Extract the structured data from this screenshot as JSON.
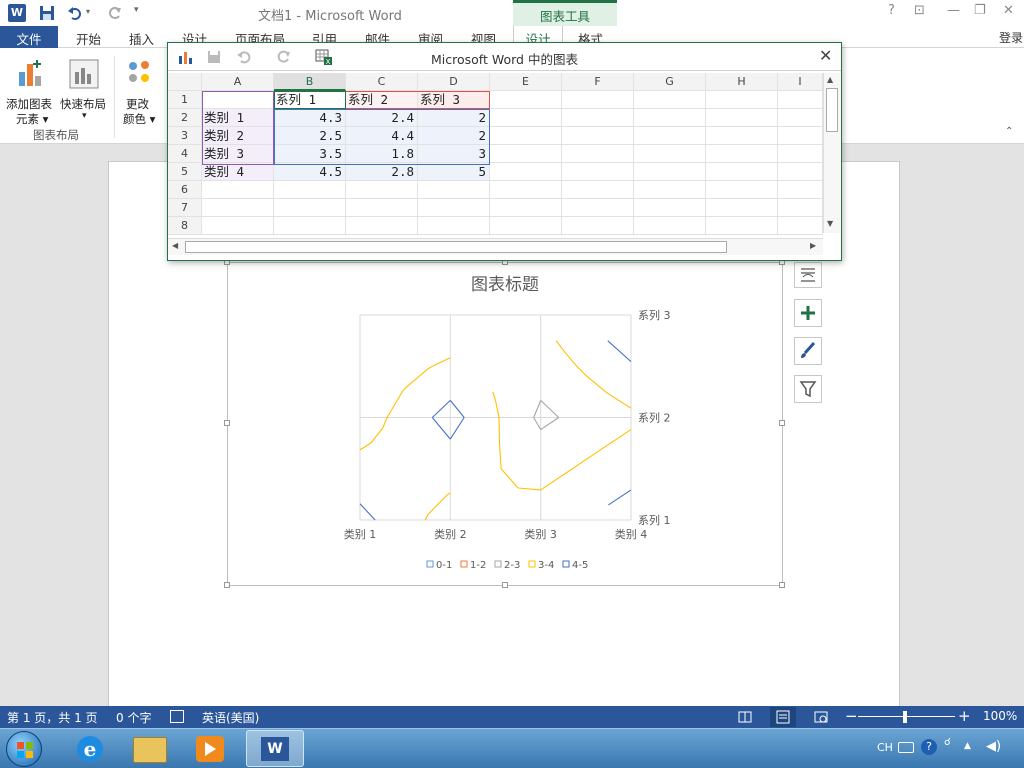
{
  "app": {
    "window_title": "文档1 - Microsoft Word",
    "context_tools_label": "图表工具",
    "help_icon": "?",
    "login_label": "登录"
  },
  "tabs": [
    "文件",
    "开始",
    "插入",
    "设计",
    "页面布局",
    "引用",
    "邮件",
    "审阅",
    "视图",
    "设计",
    "格式"
  ],
  "ribbon": {
    "add_element_line1": "添加图表",
    "add_element_line2": "元素",
    "quick_layout": "快速布局",
    "change_colors_line1": "更改",
    "change_colors_line2": "颜色",
    "group_label": "图表布局"
  },
  "data_window": {
    "title": "Microsoft Word 中的图表",
    "columns": [
      "A",
      "B",
      "C",
      "D",
      "E",
      "F",
      "G",
      "H",
      "I"
    ],
    "rows": [
      "1",
      "2",
      "3",
      "4",
      "5",
      "6",
      "7",
      "8"
    ],
    "header_row": [
      "",
      "系列 1",
      "系列 2",
      "系列 3"
    ],
    "data_rows": [
      [
        "类别 1",
        "4.3",
        "2.4",
        "2"
      ],
      [
        "类别 2",
        "2.5",
        "4.4",
        "2"
      ],
      [
        "类别 3",
        "3.5",
        "1.8",
        "3"
      ],
      [
        "类别 4",
        "4.5",
        "2.8",
        "5"
      ]
    ]
  },
  "chart_data": {
    "type": "contour",
    "title": "图表标题",
    "categories": [
      "类别 1",
      "类别 2",
      "类别 3",
      "类别 4"
    ],
    "series_names": [
      "系列 1",
      "系列 2",
      "系列 3"
    ],
    "values": [
      [
        4.3,
        2.4,
        2
      ],
      [
        2.5,
        4.4,
        2
      ],
      [
        3.5,
        1.8,
        3
      ],
      [
        4.5,
        2.8,
        5
      ]
    ],
    "legend": [
      "0-1",
      "1-2",
      "2-3",
      "3-4",
      "4-5"
    ],
    "legend_colors": [
      "#5b9bd5",
      "#ed7d31",
      "#a5a5a5",
      "#ffc000",
      "#4472c4"
    ],
    "legend_position": "bottom"
  },
  "statusbar": {
    "page": "第 1 页，共 1 页",
    "words": "0 个字",
    "language": "英语(美国)",
    "zoom": "100%"
  },
  "taskbar": {
    "lang": "CH"
  }
}
